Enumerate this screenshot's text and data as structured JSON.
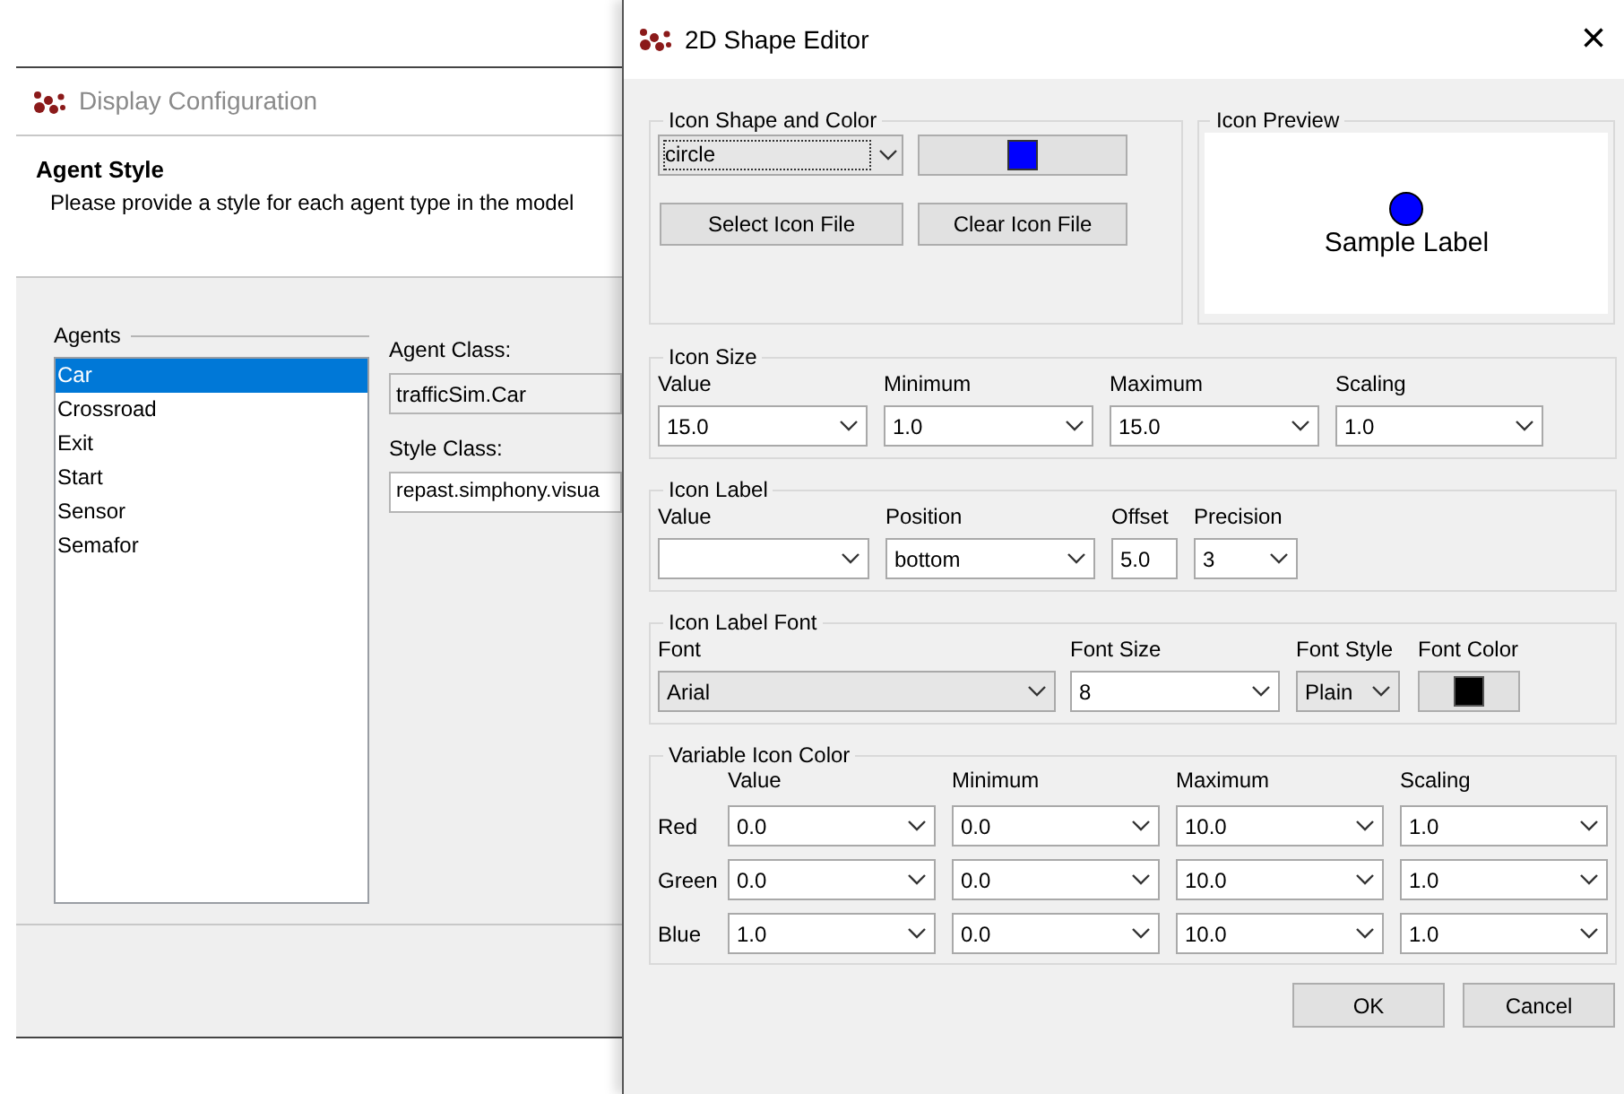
{
  "background_window": {
    "title": "Display Configuration",
    "header_title": "Agent Style",
    "header_description": "Please provide a style for each agent type in the model",
    "agents_title": "Agents",
    "agents": [
      {
        "label": "Car",
        "selected": true
      },
      {
        "label": "Crossroad",
        "selected": false
      },
      {
        "label": "Exit",
        "selected": false
      },
      {
        "label": "Start",
        "selected": false
      },
      {
        "label": "Sensor",
        "selected": false
      },
      {
        "label": "Semafor",
        "selected": false
      }
    ],
    "agent_class_label": "Agent Class:",
    "agent_class_value": "trafficSim.Car",
    "style_class_label": "Style Class:",
    "style_class_value": "repast.simphony.visua"
  },
  "dialog": {
    "title": "2D Shape Editor",
    "close": "×",
    "shape_and_color": {
      "title": "Icon Shape and Color",
      "shape": "circle",
      "color": "#0000ff",
      "buttons": [
        "Select Icon File",
        "Clear Icon File"
      ]
    },
    "preview": {
      "title": "Icon Preview",
      "color": "#0000ff",
      "label": "Sample Label"
    },
    "icon_size": {
      "title": "Icon Size",
      "fields": [
        {
          "label": "Value",
          "value": "15.0",
          "kind": "combo"
        },
        {
          "label": "Minimum",
          "value": "1.0",
          "kind": "combo"
        },
        {
          "label": "Maximum",
          "value": "15.0",
          "kind": "combo"
        },
        {
          "label": "Scaling",
          "value": "1.0",
          "kind": "combo"
        }
      ]
    },
    "icon_label": {
      "title": "Icon Label",
      "fields": [
        {
          "label": "Value",
          "kind": "combo"
        },
        {
          "label": "Position",
          "value": "bottom",
          "kind": "combo"
        },
        {
          "label": "Offset",
          "value": "5.0",
          "kind": "text"
        },
        {
          "label": "Precision",
          "value": "3",
          "kind": "combo"
        }
      ]
    },
    "icon_label_font": {
      "title": "Icon Label Font",
      "fields": [
        {
          "label": "Font",
          "value": "Arial",
          "kind": "select"
        },
        {
          "label": "Font Size",
          "value": "8",
          "kind": "combo"
        },
        {
          "label": "Font Style",
          "value": "Plain",
          "kind": "select"
        },
        {
          "label": "Font Color",
          "color": "#000000",
          "kind": "color"
        }
      ]
    },
    "variable_icon_color": {
      "title": "Variable Icon Color",
      "columns": [
        "Value",
        "Minimum",
        "Maximum",
        "Scaling"
      ],
      "rows": [
        {
          "label": "Red",
          "values": [
            "0.0",
            "0.0",
            "10.0",
            "1.0"
          ]
        },
        {
          "label": "Green",
          "values": [
            "0.0",
            "0.0",
            "10.0",
            "1.0"
          ]
        },
        {
          "label": "Blue",
          "values": [
            "1.0",
            "0.0",
            "10.0",
            "1.0"
          ]
        }
      ]
    },
    "buttons": [
      "OK",
      "Cancel"
    ]
  }
}
